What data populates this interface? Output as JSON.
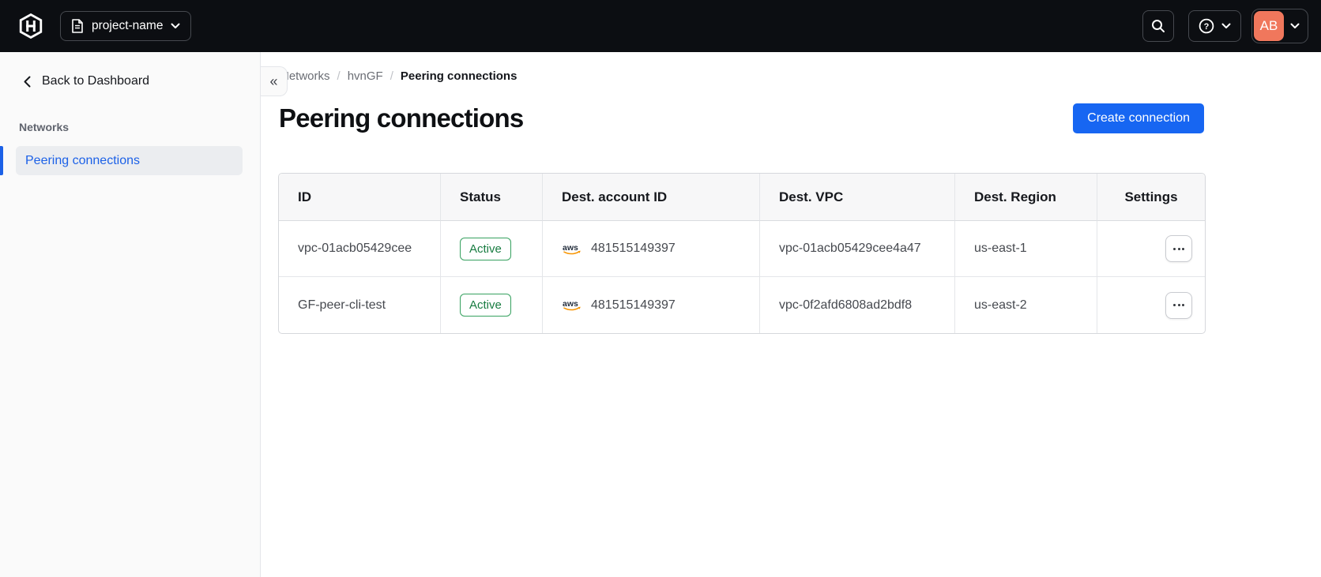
{
  "topbar": {
    "project_label": "project-name",
    "avatar_initials": "AB"
  },
  "icons": {
    "logo": "hashicorp-logo",
    "project": "document-icon",
    "search": "search-icon",
    "help": "help-circle-icon",
    "help_glyph": "?",
    "aws_label": "aws"
  },
  "sidebar": {
    "back_label": "Back to Dashboard",
    "section_label": "Networks",
    "active_item_label": "Peering connections",
    "collapse_glyph": "«"
  },
  "breadcrumb": {
    "separator": "/",
    "items": [
      "Networks",
      "hvnGF",
      "Peering connections"
    ]
  },
  "main": {
    "title": "Peering connections",
    "create_button_label": "Create connection"
  },
  "table": {
    "columns": [
      "ID",
      "Status",
      "Dest. account ID",
      "Dest. VPC",
      "Dest. Region",
      "Settings"
    ],
    "rows": [
      {
        "id": "vpc-01acb05429cee",
        "status": "Active",
        "account_id": "481515149397",
        "vpc": "vpc-01acb05429cee4a47",
        "region": "us-east-1"
      },
      {
        "id": "GF-peer-cli-test",
        "status": "Active",
        "account_id": "481515149397",
        "vpc": "vpc-0f2afd6808ad2bdf8",
        "region": "us-east-2"
      }
    ]
  },
  "colors": {
    "topbar_bg": "#0c0e12",
    "accent_blue": "#1766f2",
    "link_blue": "#1c61e7",
    "badge_green_text": "#187c41",
    "badge_green_border": "#36a15f",
    "avatar_orange": "#f0775c",
    "aws_orange": "#f79400",
    "sidebar_bg": "#fafafa"
  }
}
